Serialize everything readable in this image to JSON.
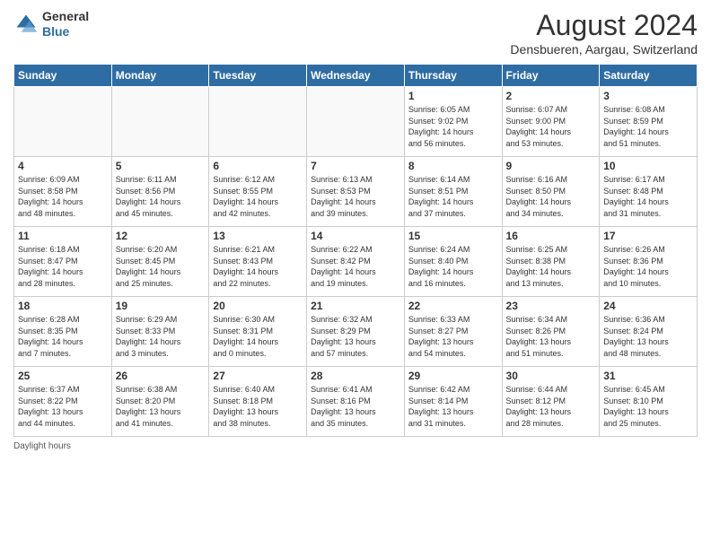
{
  "logo": {
    "general": "General",
    "blue": "Blue"
  },
  "title": "August 2024",
  "location": "Densbueren, Aargau, Switzerland",
  "days_of_week": [
    "Sunday",
    "Monday",
    "Tuesday",
    "Wednesday",
    "Thursday",
    "Friday",
    "Saturday"
  ],
  "footer": "Daylight hours",
  "weeks": [
    [
      {
        "num": "",
        "info": ""
      },
      {
        "num": "",
        "info": ""
      },
      {
        "num": "",
        "info": ""
      },
      {
        "num": "",
        "info": ""
      },
      {
        "num": "1",
        "info": "Sunrise: 6:05 AM\nSunset: 9:02 PM\nDaylight: 14 hours\nand 56 minutes."
      },
      {
        "num": "2",
        "info": "Sunrise: 6:07 AM\nSunset: 9:00 PM\nDaylight: 14 hours\nand 53 minutes."
      },
      {
        "num": "3",
        "info": "Sunrise: 6:08 AM\nSunset: 8:59 PM\nDaylight: 14 hours\nand 51 minutes."
      }
    ],
    [
      {
        "num": "4",
        "info": "Sunrise: 6:09 AM\nSunset: 8:58 PM\nDaylight: 14 hours\nand 48 minutes."
      },
      {
        "num": "5",
        "info": "Sunrise: 6:11 AM\nSunset: 8:56 PM\nDaylight: 14 hours\nand 45 minutes."
      },
      {
        "num": "6",
        "info": "Sunrise: 6:12 AM\nSunset: 8:55 PM\nDaylight: 14 hours\nand 42 minutes."
      },
      {
        "num": "7",
        "info": "Sunrise: 6:13 AM\nSunset: 8:53 PM\nDaylight: 14 hours\nand 39 minutes."
      },
      {
        "num": "8",
        "info": "Sunrise: 6:14 AM\nSunset: 8:51 PM\nDaylight: 14 hours\nand 37 minutes."
      },
      {
        "num": "9",
        "info": "Sunrise: 6:16 AM\nSunset: 8:50 PM\nDaylight: 14 hours\nand 34 minutes."
      },
      {
        "num": "10",
        "info": "Sunrise: 6:17 AM\nSunset: 8:48 PM\nDaylight: 14 hours\nand 31 minutes."
      }
    ],
    [
      {
        "num": "11",
        "info": "Sunrise: 6:18 AM\nSunset: 8:47 PM\nDaylight: 14 hours\nand 28 minutes."
      },
      {
        "num": "12",
        "info": "Sunrise: 6:20 AM\nSunset: 8:45 PM\nDaylight: 14 hours\nand 25 minutes."
      },
      {
        "num": "13",
        "info": "Sunrise: 6:21 AM\nSunset: 8:43 PM\nDaylight: 14 hours\nand 22 minutes."
      },
      {
        "num": "14",
        "info": "Sunrise: 6:22 AM\nSunset: 8:42 PM\nDaylight: 14 hours\nand 19 minutes."
      },
      {
        "num": "15",
        "info": "Sunrise: 6:24 AM\nSunset: 8:40 PM\nDaylight: 14 hours\nand 16 minutes."
      },
      {
        "num": "16",
        "info": "Sunrise: 6:25 AM\nSunset: 8:38 PM\nDaylight: 14 hours\nand 13 minutes."
      },
      {
        "num": "17",
        "info": "Sunrise: 6:26 AM\nSunset: 8:36 PM\nDaylight: 14 hours\nand 10 minutes."
      }
    ],
    [
      {
        "num": "18",
        "info": "Sunrise: 6:28 AM\nSunset: 8:35 PM\nDaylight: 14 hours\nand 7 minutes."
      },
      {
        "num": "19",
        "info": "Sunrise: 6:29 AM\nSunset: 8:33 PM\nDaylight: 14 hours\nand 3 minutes."
      },
      {
        "num": "20",
        "info": "Sunrise: 6:30 AM\nSunset: 8:31 PM\nDaylight: 14 hours\nand 0 minutes."
      },
      {
        "num": "21",
        "info": "Sunrise: 6:32 AM\nSunset: 8:29 PM\nDaylight: 13 hours\nand 57 minutes."
      },
      {
        "num": "22",
        "info": "Sunrise: 6:33 AM\nSunset: 8:27 PM\nDaylight: 13 hours\nand 54 minutes."
      },
      {
        "num": "23",
        "info": "Sunrise: 6:34 AM\nSunset: 8:26 PM\nDaylight: 13 hours\nand 51 minutes."
      },
      {
        "num": "24",
        "info": "Sunrise: 6:36 AM\nSunset: 8:24 PM\nDaylight: 13 hours\nand 48 minutes."
      }
    ],
    [
      {
        "num": "25",
        "info": "Sunrise: 6:37 AM\nSunset: 8:22 PM\nDaylight: 13 hours\nand 44 minutes."
      },
      {
        "num": "26",
        "info": "Sunrise: 6:38 AM\nSunset: 8:20 PM\nDaylight: 13 hours\nand 41 minutes."
      },
      {
        "num": "27",
        "info": "Sunrise: 6:40 AM\nSunset: 8:18 PM\nDaylight: 13 hours\nand 38 minutes."
      },
      {
        "num": "28",
        "info": "Sunrise: 6:41 AM\nSunset: 8:16 PM\nDaylight: 13 hours\nand 35 minutes."
      },
      {
        "num": "29",
        "info": "Sunrise: 6:42 AM\nSunset: 8:14 PM\nDaylight: 13 hours\nand 31 minutes."
      },
      {
        "num": "30",
        "info": "Sunrise: 6:44 AM\nSunset: 8:12 PM\nDaylight: 13 hours\nand 28 minutes."
      },
      {
        "num": "31",
        "info": "Sunrise: 6:45 AM\nSunset: 8:10 PM\nDaylight: 13 hours\nand 25 minutes."
      }
    ]
  ]
}
